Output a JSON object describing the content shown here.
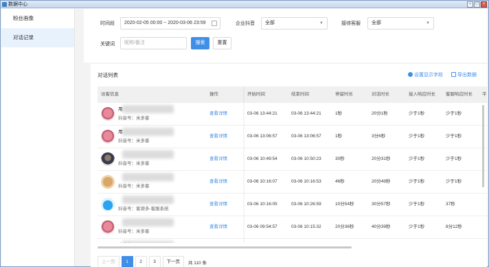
{
  "window": {
    "title": "数据中心"
  },
  "sidebar": {
    "items": [
      {
        "label": "粉丝画像"
      },
      {
        "label": "对话记录"
      }
    ]
  },
  "filters": {
    "time_label": "时间段",
    "time_value": "2020-02-05 00:00 ~ 2020-03-06 23:59",
    "account_label": "企业抖音",
    "account_value": "全部",
    "agent_label": "接待客服",
    "agent_value": "全部",
    "keyword_label": "关键词",
    "keyword_placeholder": "昵称/备注",
    "search_button": "搜索",
    "reset_button": "重置"
  },
  "list": {
    "title": "对话列表",
    "settings_link": "设置显示字段",
    "export_link": "导出数据",
    "columns": [
      "访客信息",
      "操作",
      "开始时间",
      "结束时间",
      "停留时长",
      "对话时长",
      "接入响应时长",
      "客服响应时长",
      "平"
    ],
    "rows": [
      {
        "name": "用",
        "sub": "抖音号：米多客",
        "action": "查看详情",
        "start": "03-06 13:44:21",
        "end": "03-06 13:44:21",
        "stay": "1秒",
        "dialog": "20分1秒",
        "access": "少于1秒",
        "reply": "少于1秒",
        "avatar": "pink"
      },
      {
        "name": "用",
        "sub": "抖音号：米多客",
        "action": "查看详情",
        "start": "03-06 13:06:57",
        "end": "03-06 13:06:57",
        "stay": "1秒",
        "dialog": "3分6秒",
        "access": "少于1秒",
        "reply": "少于1秒",
        "avatar": "pink"
      },
      {
        "name": "",
        "sub": "抖音号：米多客",
        "action": "查看详情",
        "start": "03-06 10:49:54",
        "end": "03-06 10:50:23",
        "stay": "30秒",
        "dialog": "20分31秒",
        "access": "少于1秒",
        "reply": "少于1秒",
        "avatar": "dark"
      },
      {
        "name": "",
        "sub": "抖音号：米多客",
        "action": "查看详情",
        "start": "03-06 10:16:07",
        "end": "03-06 10:16:53",
        "stay": "46秒",
        "dialog": "20分49秒",
        "access": "少于1秒",
        "reply": "少于1秒",
        "avatar": "tan"
      },
      {
        "name": "",
        "sub": "抖音号：客源多-客服系统",
        "action": "查看详情",
        "start": "03-06 10:16:05",
        "end": "03-06 10:26:59",
        "stay": "10分54秒",
        "dialog": "30分57秒",
        "access": "少于1秒",
        "reply": "37秒",
        "avatar": "blue"
      },
      {
        "name": "",
        "sub": "抖音号：米多客",
        "action": "查看详情",
        "start": "03-06 09:54:57",
        "end": "03-06 10:15:32",
        "stay": "20分36秒",
        "dialog": "40分39秒",
        "access": "少于1秒",
        "reply": "8分12秒",
        "avatar": "pink"
      },
      {
        "name": "米多客",
        "sub": "",
        "action": "",
        "start": "",
        "end": "",
        "stay": "",
        "dialog": "",
        "access": "",
        "reply": "",
        "avatar": "blue"
      }
    ]
  },
  "pagination": {
    "prev": "上一页",
    "pages": [
      "1",
      "2",
      "3"
    ],
    "current": "1",
    "next": "下一页",
    "total": "共 110 条"
  }
}
